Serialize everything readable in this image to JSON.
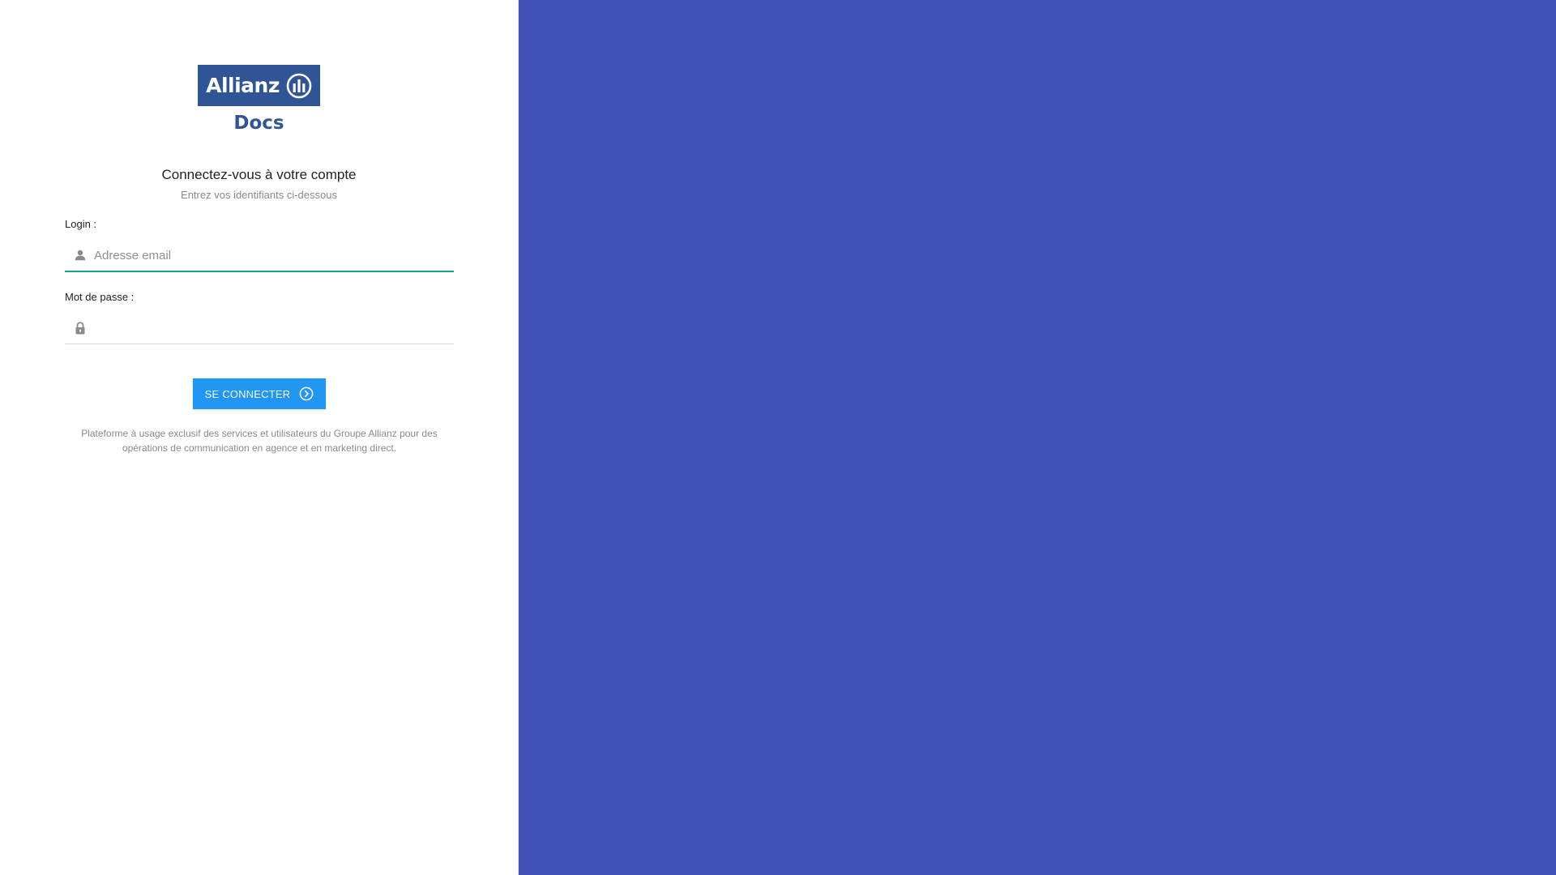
{
  "brand": {
    "logo_text": "Allianz",
    "product_name": "Docs",
    "logo_color": "#2f5597",
    "logo_mark_icon": "allianz-eagle-mark"
  },
  "login_form": {
    "title": "Connectez-vous à votre compte",
    "subtitle": "Entrez vos identifiants ci-dessous",
    "login_label": "Login :",
    "login_placeholder": "Adresse email",
    "login_value": "",
    "login_icon": "user-icon",
    "password_label": "Mot de passe :",
    "password_value": "",
    "password_icon": "lock-icon",
    "submit_label": "SE CONNECTER",
    "submit_icon": "chevron-right-circle-icon",
    "active_field_color": "#14a08e",
    "submit_color": "#2196f3"
  },
  "footer": {
    "note": "Plateforme à usage exclusif des services et utilisateurs du Groupe Allianz pour des opérations de communication en agence et en marketing direct."
  },
  "side_panel": {
    "color": "#3f51b5"
  }
}
